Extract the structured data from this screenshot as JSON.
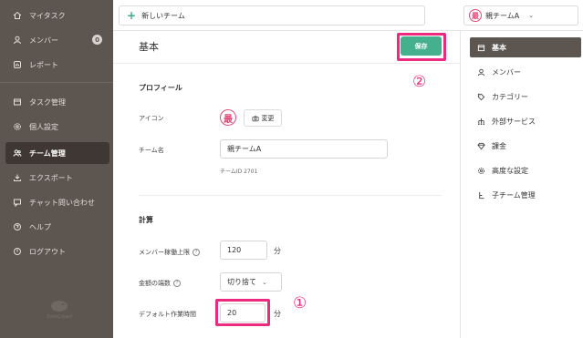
{
  "sidebar": {
    "items": [
      {
        "label": "マイタスク",
        "icon": "home-icon"
      },
      {
        "label": "メンバー",
        "icon": "user-icon",
        "badge": "0"
      },
      {
        "label": "レポート",
        "icon": "report-icon"
      },
      {
        "label": "タスク管理",
        "icon": "task-icon"
      },
      {
        "label": "個人設定",
        "icon": "gear-icon"
      },
      {
        "label": "チーム管理",
        "icon": "team-icon"
      },
      {
        "label": "エクスポート",
        "icon": "export-icon"
      },
      {
        "label": "チャット問い合わせ",
        "icon": "chat-icon"
      },
      {
        "label": "ヘルプ",
        "icon": "help-icon"
      },
      {
        "label": "ログアウト",
        "icon": "logout-icon"
      }
    ],
    "active_index": 5,
    "logo_text": "TimeCrowd"
  },
  "topbar": {
    "new_team_label": "新しいチーム",
    "team_name": "親チームA",
    "team_avatar_char": "最"
  },
  "main": {
    "title": "基本",
    "save_label": "保存",
    "annotation_save": "②",
    "annotation_field": "①",
    "profile": {
      "heading": "プロフィール",
      "icon_label": "アイコン",
      "avatar_char": "最",
      "change_label": "変更",
      "team_name_label": "チーム名",
      "team_name_value": "親チームA",
      "team_id": "チームID 2701"
    },
    "calc": {
      "heading": "計算",
      "member_limit_label": "メンバー稼働上限",
      "member_limit_value": "120",
      "member_limit_unit": "分",
      "rounding_label": "金額の端数",
      "rounding_value": "切り捨て",
      "default_time_label": "デフォルト作業時間",
      "default_time_value": "20",
      "default_time_unit": "分"
    }
  },
  "rightnav": {
    "items": [
      {
        "label": "基本",
        "icon": "basic-icon"
      },
      {
        "label": "メンバー",
        "icon": "user-icon"
      },
      {
        "label": "カテゴリー",
        "icon": "tag-icon"
      },
      {
        "label": "外部サービス",
        "icon": "integration-icon"
      },
      {
        "label": "課金",
        "icon": "diamond-icon"
      },
      {
        "label": "高度な設定",
        "icon": "gear-icon"
      },
      {
        "label": "子チーム管理",
        "icon": "subteam-icon"
      }
    ],
    "active_index": 0
  },
  "colors": {
    "sidebar_bg": "#5d5550",
    "accent_green": "#45b08e",
    "highlight_pink": "#ec2a7f"
  }
}
